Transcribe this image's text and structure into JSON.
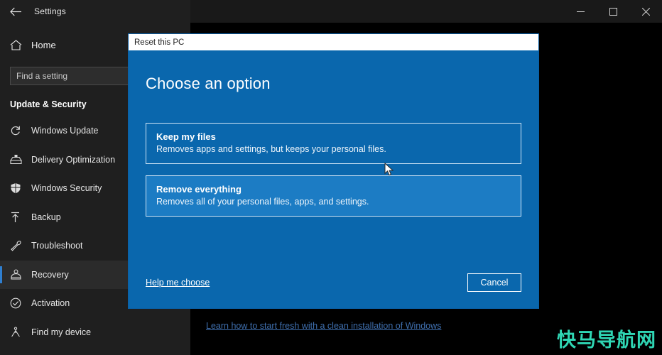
{
  "window": {
    "title": "Settings",
    "back_icon": "back-arrow-icon",
    "controls": [
      {
        "name": "minimize",
        "glyph": "minimize-icon"
      },
      {
        "name": "maximize",
        "glyph": "maximize-icon"
      },
      {
        "name": "close",
        "glyph": "close-icon"
      }
    ]
  },
  "sidebar": {
    "home_label": "Home",
    "home_icon": "home-icon",
    "search": {
      "placeholder": "Find a setting",
      "value": ""
    },
    "section_title": "Update & Security",
    "items": [
      {
        "label": "Windows Update",
        "icon": "sync-icon",
        "selected": false
      },
      {
        "label": "Delivery Optimization",
        "icon": "delivery-box-icon",
        "selected": false
      },
      {
        "label": "Windows Security",
        "icon": "shield-icon",
        "selected": false
      },
      {
        "label": "Backup",
        "icon": "upload-arrow-icon",
        "selected": false
      },
      {
        "label": "Troubleshoot",
        "icon": "wrench-icon",
        "selected": false
      },
      {
        "label": "Recovery",
        "icon": "recovery-icon",
        "selected": true
      },
      {
        "label": "Activation",
        "icon": "check-circle-icon",
        "selected": false
      },
      {
        "label": "Find my device",
        "icon": "find-device-icon",
        "selected": false
      }
    ]
  },
  "main": {
    "learn_link": "Learn how to start fresh with a clean installation of Windows",
    "watermark": "快马导航网"
  },
  "dialog": {
    "title": "Reset this PC",
    "heading": "Choose an option",
    "options": [
      {
        "title": "Keep my files",
        "description": "Removes apps and settings, but keeps your personal files.",
        "hovered": false
      },
      {
        "title": "Remove everything",
        "description": "Removes all of your personal files, apps, and settings.",
        "hovered": true
      }
    ],
    "help_link": "Help me choose",
    "cancel_label": "Cancel"
  },
  "colors": {
    "dialog_blue": "#0a67ad",
    "dialog_blue_hover": "#1c7cc4",
    "accent": "#2f7fd0",
    "sidebar_bg": "#1f1f1f",
    "content_bg": "#000000",
    "watermark": "#2fd6b4",
    "learn_link": "#3f6fae"
  }
}
